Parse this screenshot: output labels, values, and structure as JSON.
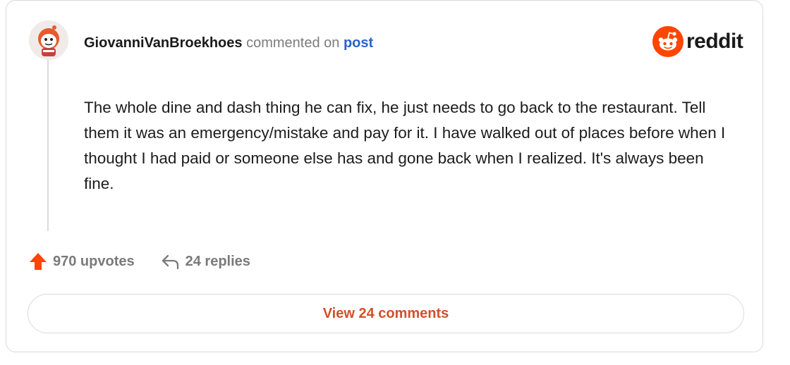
{
  "comment": {
    "username": "GiovanniVanBroekhoes",
    "action_text": "commented on",
    "link_text": "post",
    "body": "The whole dine and dash thing he can fix, he just needs to go back to the restaurant. Tell them it was an emergency/mistake and pay for it. I have walked out of places before when I thought I had paid or someone else has and gone back when I realized. It's always been fine."
  },
  "brand": {
    "name": "reddit",
    "color": "#ff4500"
  },
  "stats": {
    "upvotes_label": "970 upvotes",
    "replies_label": "24 replies",
    "upvote_color": "#ff4500"
  },
  "cta": {
    "label": "View 24 comments",
    "color": "#d1502b"
  },
  "icons": [
    "avatar",
    "reddit-logo-icon",
    "upvote-arrow-icon",
    "reply-arrow-icon"
  ]
}
